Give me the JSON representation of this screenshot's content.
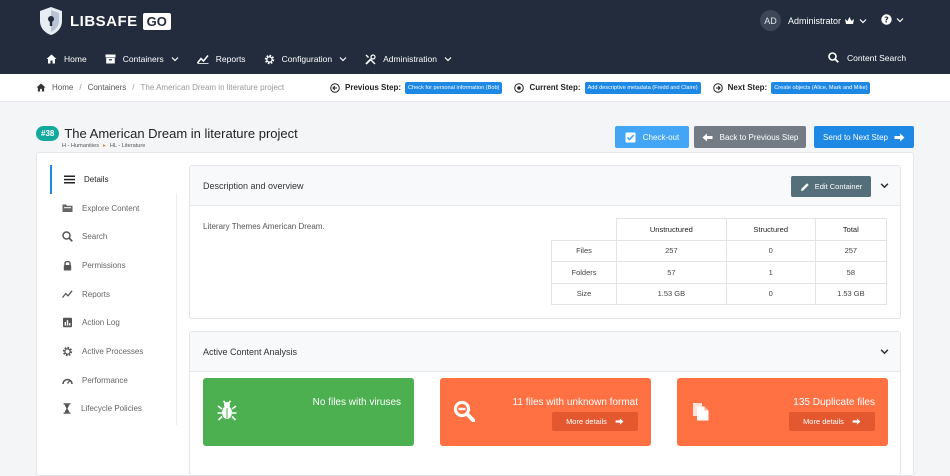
{
  "brand": {
    "name": "LIBSAFE",
    "badge": "GO"
  },
  "user": {
    "initials": "AD",
    "name": "Administrator",
    "role_icon": "crown-icon"
  },
  "nav": {
    "home": "Home",
    "containers": "Containers",
    "reports": "Reports",
    "configuration": "Configuration",
    "administration": "Administration",
    "content_search": "Content Search"
  },
  "breadcrumb": {
    "home": "Home",
    "containers": "Containers",
    "current": "The American Dream in literature project"
  },
  "workflow": {
    "previous_label": "Previous Step:",
    "previous_value": "Check for personal information (Bob)",
    "current_label": "Current Step:",
    "current_value": "Add descriptive metadata (Fredd and Claire)",
    "next_label": "Next Step:",
    "next_value": "Create objects (Alice, Mark and Mike)"
  },
  "project": {
    "id_badge": "#38",
    "title": "The American Dream in literature project",
    "category": "H - Humanities",
    "subcategory": "HL - Literature"
  },
  "actions": {
    "checkout": "Check-out",
    "back": "Back to Previous Step",
    "next": "Send to Next Step"
  },
  "sidebar": {
    "items": [
      {
        "label": "Details",
        "icon": "list-icon"
      },
      {
        "label": "Explore Content",
        "icon": "folder-icon"
      },
      {
        "label": "Search",
        "icon": "search-icon"
      },
      {
        "label": "Permissions",
        "icon": "lock-icon"
      },
      {
        "label": "Reports",
        "icon": "chart-icon"
      },
      {
        "label": "Action Log",
        "icon": "log-icon"
      },
      {
        "label": "Active Processes",
        "icon": "gear-icon"
      },
      {
        "label": "Performance",
        "icon": "gauge-icon"
      },
      {
        "label": "Lifecycle Policies",
        "icon": "hourglass-icon"
      }
    ]
  },
  "overview": {
    "heading": "Description and overview",
    "edit_label": "Edit Container",
    "description": "Literary Themes American Dream.",
    "table": {
      "columns": [
        "Unstructured",
        "Structured",
        "Total"
      ],
      "rows": [
        {
          "label": "Files",
          "values": [
            "257",
            "0",
            "257"
          ]
        },
        {
          "label": "Folders",
          "values": [
            "57",
            "1",
            "58"
          ]
        },
        {
          "label": "Size",
          "values": [
            "1.53 GB",
            "0",
            "1.53 GB"
          ]
        }
      ]
    }
  },
  "analysis": {
    "heading": "Active Content Analysis",
    "tiles": [
      {
        "text": "No files with viruses",
        "color": "#4caf50",
        "icon": "bug-icon"
      },
      {
        "text": "11 files with unknown format",
        "more": "More details",
        "color": "#ff7043",
        "icon": "search-minus-icon"
      },
      {
        "text": "135 Duplicate files",
        "more": "More details",
        "color": "#ff7043",
        "icon": "copy-icon"
      }
    ]
  }
}
